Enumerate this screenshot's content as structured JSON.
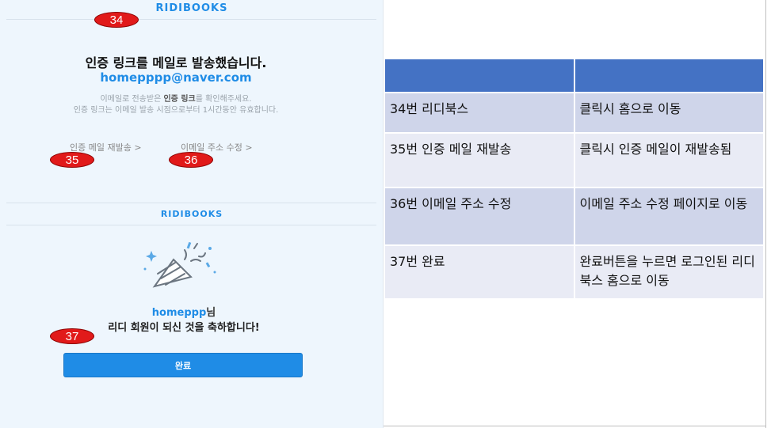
{
  "mockup": {
    "brand_top": "RIDIBOOKS",
    "title": "인증 링크를 메일로 발송했습니다.",
    "email": "homepppp@naver.com",
    "desc_line1_prefix": "이메일로 전송받은 ",
    "desc_line1_bold": "인증 링크",
    "desc_line1_suffix": "를 확인해주세요.",
    "desc_line2": "인증 링크는 이메일 발송 시점으로부터 1시간동안 유효합니다.",
    "resend_link": "인증 메일 재발송 >",
    "change_link": "이메일 주소 수정 >",
    "brand_mid": "RIDIBOOKS",
    "username": "homeppp",
    "username_suffix": "님",
    "congrats": "리디 회원이 되신 것을 축하합니다!",
    "done_button": "완료"
  },
  "badges": [
    "34",
    "35",
    "36",
    "37"
  ],
  "table": {
    "header": [
      "",
      ""
    ],
    "rows": [
      {
        "item": "34번 리디북스",
        "action": "클릭시 홈으로 이동"
      },
      {
        "item": "35번 인증 메일 재발송",
        "action": "클릭시 인증 메일이 재발송됨"
      },
      {
        "item": "36번 이메일 주소 수정",
        "action": "이메일 주소 수정 페이지로 이동"
      },
      {
        "item": "37번 완료",
        "action": "완료버튼을 누르면 로그인된 리디북스 홈으로 이동"
      }
    ]
  },
  "colors": {
    "brand_blue": "#1f8ce6",
    "badge_red": "#e11a1a",
    "table_header": "#4472c4"
  }
}
